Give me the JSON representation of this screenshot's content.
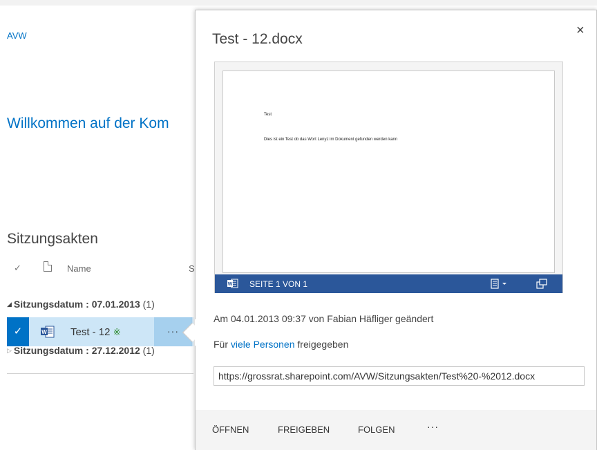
{
  "site": {
    "link_label": "AVW"
  },
  "page": {
    "welcome_text": "Willkommen auf der Kom"
  },
  "library": {
    "title": "Sitzungsakten",
    "columns": {
      "check_symbol": "✓",
      "name": "Name",
      "next_col_fragment": "S"
    },
    "groups": [
      {
        "toggle": "◢",
        "label": "Sitzungsdatum : 07.01.2013",
        "count": "(1)"
      },
      {
        "toggle": "▷",
        "label": "Sitzungsdatum : 27.12.2012",
        "count": "(1)"
      }
    ],
    "selected_row": {
      "check_symbol": "✓",
      "icon": "word-doc-icon",
      "name": "Test - 12",
      "new_marker": "※",
      "more_label": "···"
    }
  },
  "callout": {
    "title": "Test - 12.docx",
    "close_symbol": "×",
    "preview": {
      "doc_line1": "Test",
      "doc_line2": "Dies ist ein Test ob das Wort Lenyz im Dokument gefunden werden kann",
      "page_label": "SEITE 1 VON 1",
      "bar_color": "#2b579a"
    },
    "modified_text": "Am 04.01.2013 09:37 von Fabian Häfliger geändert",
    "shared_prefix": "Für ",
    "shared_link": "viele Personen",
    "shared_suffix": " freigegeben",
    "url": "https://grossrat.sharepoint.com/AVW/Sitzungsakten/Test%20-%2012.docx",
    "actions": {
      "open": "ÖFFNEN",
      "share": "FREIGEBEN",
      "follow": "FOLGEN",
      "more": "···"
    }
  },
  "colors": {
    "accent": "#0072c6",
    "selection": "#cde6f7",
    "selection_dark": "#a6d0ee"
  }
}
